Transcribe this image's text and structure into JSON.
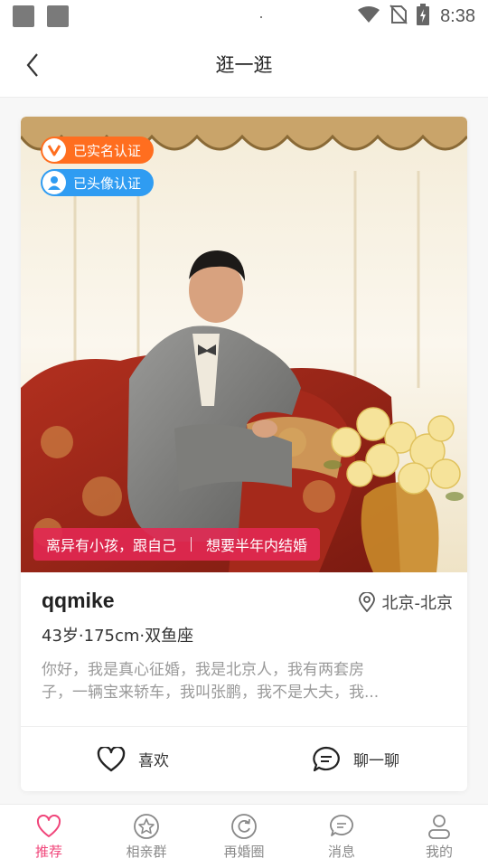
{
  "status_bar": {
    "time": "8:38"
  },
  "nav": {
    "title": "逛一逛"
  },
  "profile": {
    "badges": [
      "已实名认证",
      "已头像认证"
    ],
    "tags": [
      "离异有小孩，跟自己",
      "想要半年内结婚"
    ],
    "username": "qqmike",
    "location": "北京-北京",
    "basic_info": "43岁·175cm·双鱼座",
    "intro_lines": [
      "你好，我是真心征婚，我是北京人，我有两套房",
      "子，一辆宝来轿车，我叫张鹏，我不是大夫，我..."
    ],
    "actions": {
      "like": "喜欢",
      "chat": "聊一聊"
    }
  },
  "tabbar": {
    "items": [
      {
        "label": "推荐",
        "icon": "heart-icon",
        "active": true
      },
      {
        "label": "相亲群",
        "icon": "star-circle-icon",
        "active": false
      },
      {
        "label": "再婚圈",
        "icon": "refresh-circle-icon",
        "active": false
      },
      {
        "label": "消息",
        "icon": "chat-bubble-icon",
        "active": false
      },
      {
        "label": "我的",
        "icon": "person-icon",
        "active": false
      }
    ]
  },
  "colors": {
    "accent": "#f0457a",
    "tag_bg": "#e22852",
    "badge_real": "#ff6e1f",
    "badge_avatar": "#2f9cf2"
  }
}
